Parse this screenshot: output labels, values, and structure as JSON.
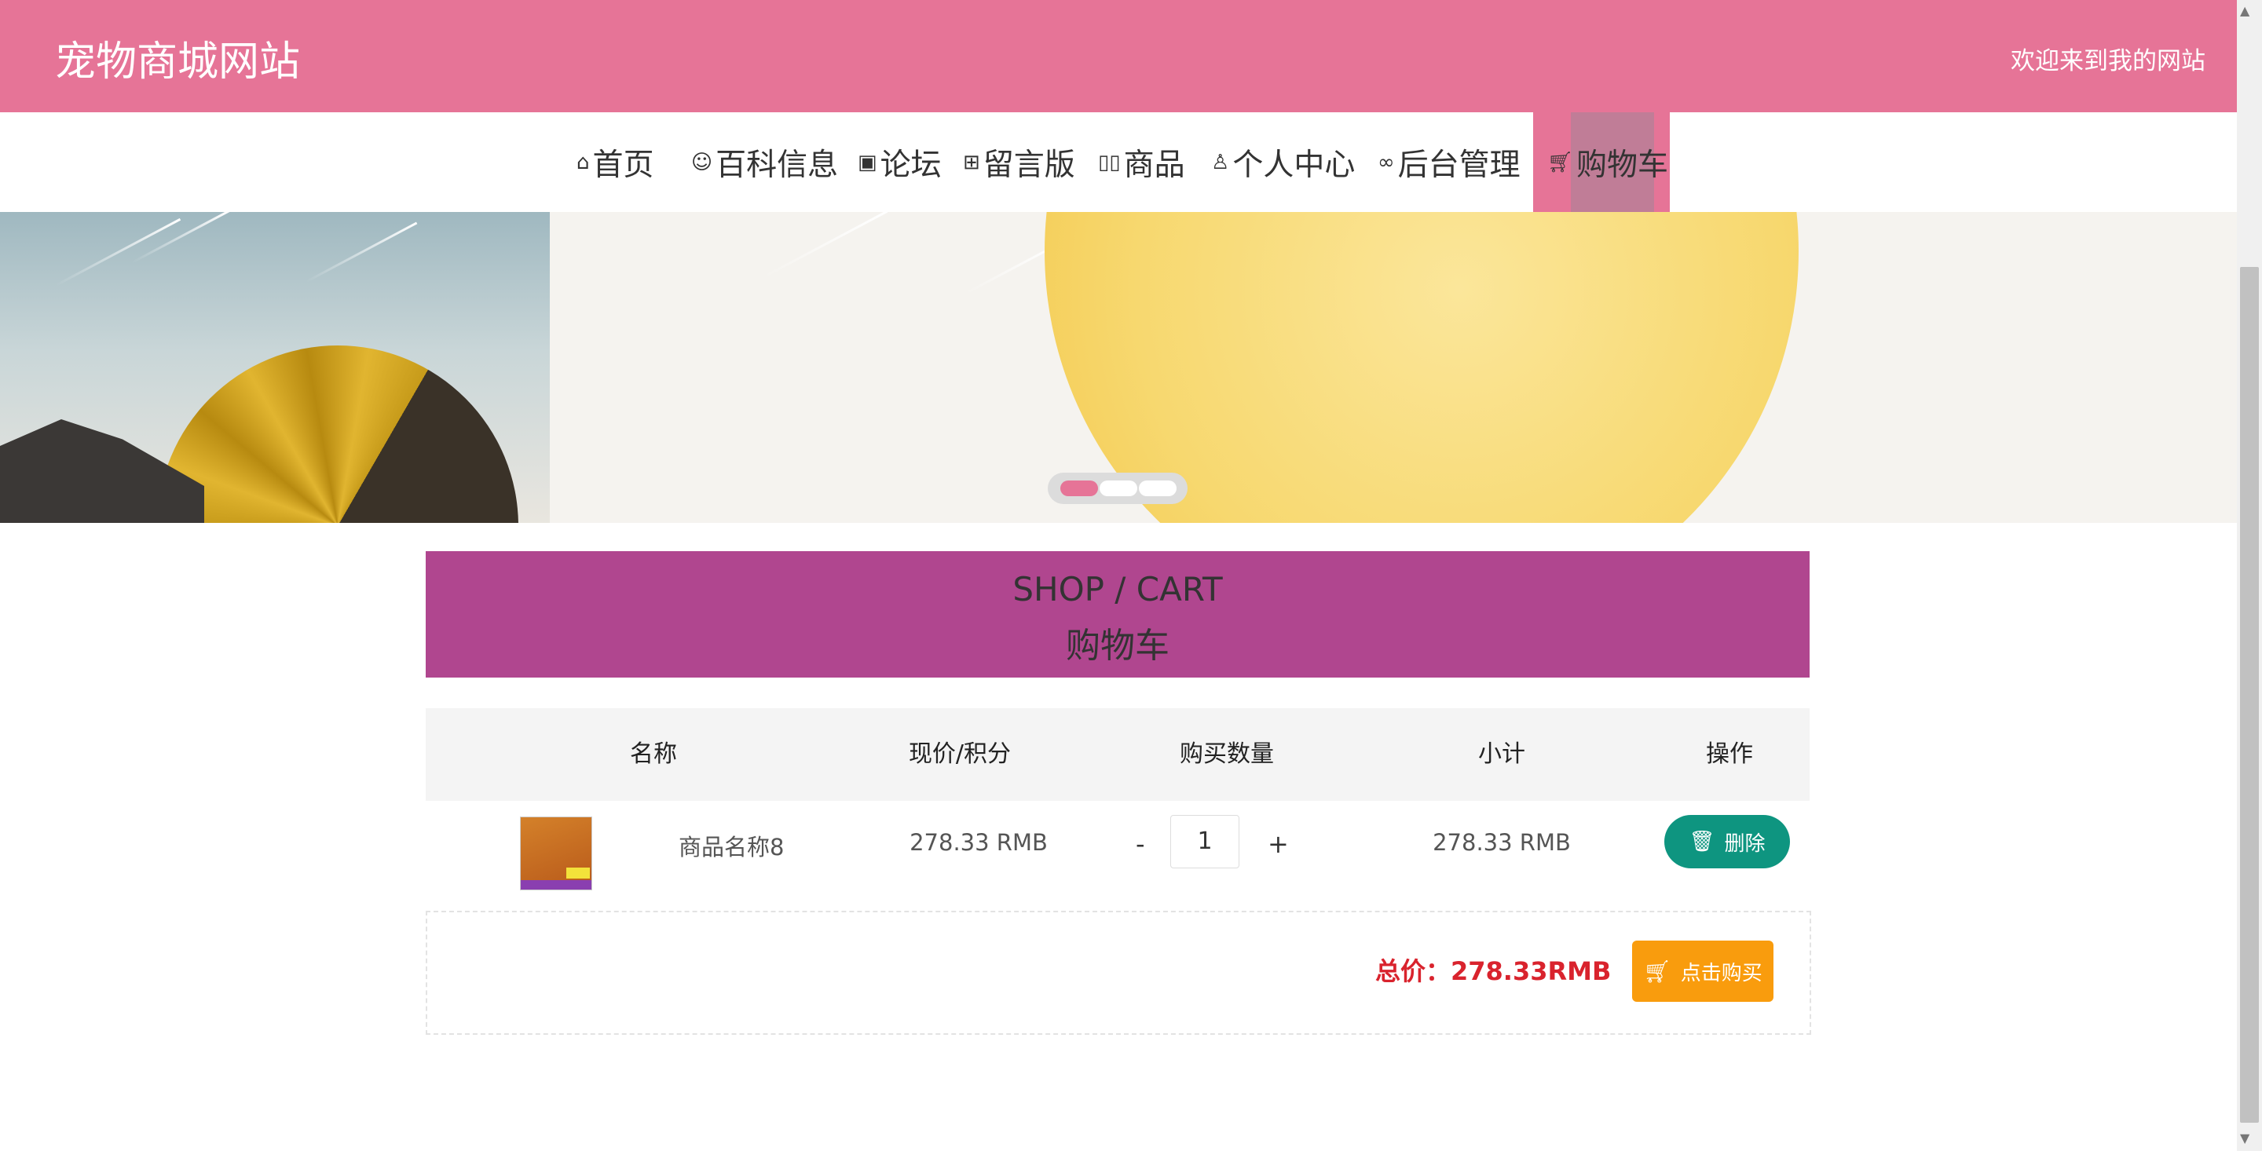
{
  "header": {
    "site_title": "宠物商城网站",
    "welcome": "欢迎来到我的网站"
  },
  "nav": {
    "items": [
      {
        "icon": "home-icon",
        "label": "首页"
      },
      {
        "icon": "smile-icon",
        "label": "百科信息"
      },
      {
        "icon": "gift-icon",
        "label": "论坛"
      },
      {
        "icon": "grid-icon",
        "label": "留言版"
      },
      {
        "icon": "book-icon",
        "label": "商品"
      },
      {
        "icon": "user-icon",
        "label": "个人中心"
      },
      {
        "icon": "link-icon",
        "label": "后台管理"
      },
      {
        "icon": "cart-icon",
        "label": "购物车"
      }
    ],
    "active_index": 7
  },
  "banner": {
    "slides_total": 3,
    "active_slide": 1
  },
  "shop": {
    "title_en": "SHOP / CART",
    "title_cn": "购物车"
  },
  "table": {
    "headers": [
      "名称",
      "现价/积分",
      "购买数量",
      "小计",
      "操作"
    ],
    "rows": [
      {
        "name": "商品名称8",
        "price": "278.33 RMB",
        "qty_minus": "-",
        "quantity": "1",
        "qty_plus": "+",
        "subtotal": "278.33 RMB",
        "delete_label": "删除"
      }
    ]
  },
  "summary": {
    "total": "总价：278.33RMB",
    "buy_label": "点击购买"
  },
  "colors": {
    "header_bg": "#e67497",
    "heading_bg": "#b0468f",
    "delete_btn": "#0e9580",
    "buy_btn": "#f99c0d",
    "total_text": "#d9232d"
  }
}
